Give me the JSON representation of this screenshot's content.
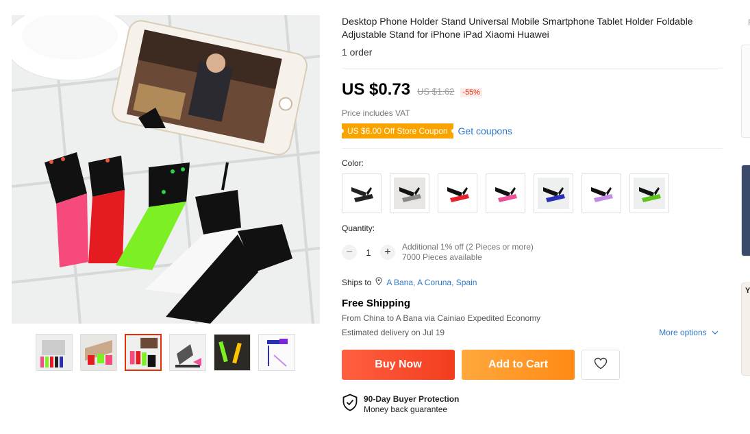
{
  "product": {
    "title": "Desktop Phone Holder Stand Universal Mobile Smartphone Tablet Holder Foldable Adjustable Stand for iPhone iPad Xiaomi Huawei",
    "orders": "1 order",
    "price": "US $0.73",
    "old_price": "US $1.62",
    "discount": "-55%",
    "vat_note": "Price includes VAT",
    "coupon": "US $6.00 Off Store Coupon",
    "get_coupons": "Get coupons"
  },
  "color": {
    "label": "Color:",
    "swatches": [
      {
        "name": "black",
        "hex": "#222222"
      },
      {
        "name": "grey",
        "hex": "#8a8a8a"
      },
      {
        "name": "red",
        "hex": "#e8212a"
      },
      {
        "name": "pink",
        "hex": "#f0509a"
      },
      {
        "name": "blue",
        "hex": "#2a2fb8"
      },
      {
        "name": "purple",
        "hex": "#c58be8"
      },
      {
        "name": "green",
        "hex": "#5cc41a"
      }
    ]
  },
  "quantity": {
    "label": "Quantity:",
    "minus": "−",
    "value": "1",
    "plus": "+",
    "note1": "Additional 1% off (2 Pieces or more)",
    "note2": "7000 Pieces available"
  },
  "shipping": {
    "ships_to_label": "Ships to",
    "location": "A Bana, A Coruna, Spain",
    "free_shipping": "Free Shipping",
    "route": "From China to A Bana via Cainiao Expedited Economy",
    "delivery": "Estimated delivery on Jul 19",
    "more_options": "More options"
  },
  "actions": {
    "buy_now": "Buy Now",
    "add_to_cart": "Add to Cart"
  },
  "protection": {
    "title": "90-Day Buyer Protection",
    "subtitle": "Money back guarantee"
  },
  "right_panel": {
    "top_char": "F",
    "card_char": "Y"
  },
  "colors": {
    "accent": "#e62e04",
    "link": "#2e77c8",
    "coupon": "#f8a300"
  }
}
